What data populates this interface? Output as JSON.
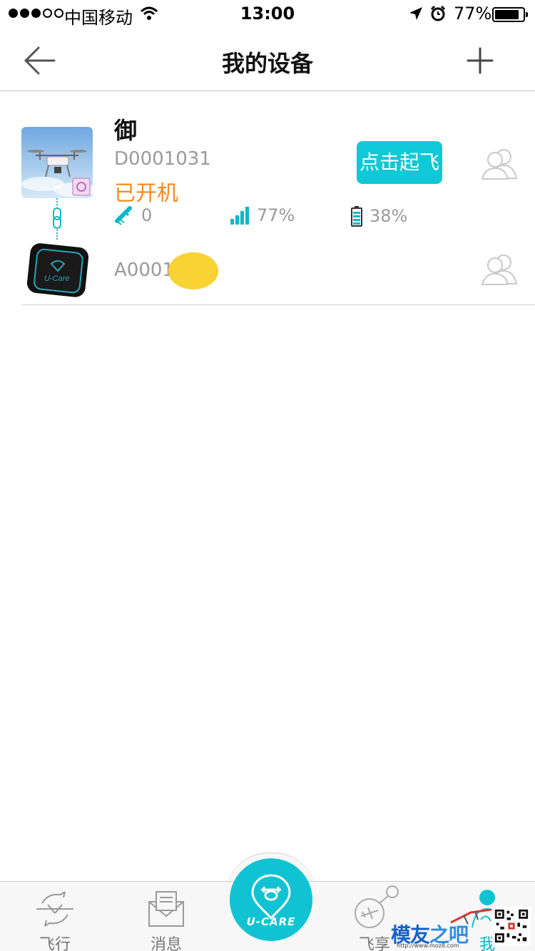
{
  "status_bar": {
    "carrier": "中国移动",
    "time": "13:00",
    "battery_percent": "77%"
  },
  "nav": {
    "title": "我的设备"
  },
  "device": {
    "name": "御",
    "id": "D0001031",
    "status": "已开机",
    "gps_count": "0",
    "signal": "77%",
    "battery": "38%",
    "takeoff_label": "点击起飞",
    "tracker_id": "A0001"
  },
  "tabs": {
    "fly": "飞行",
    "messages": "消息",
    "center_brand": "U-CARE",
    "share": "飞享",
    "me": "我"
  },
  "watermark": {
    "text_a": "模友",
    "text_b": "之吧",
    "url": "http://www.moz8.com"
  },
  "colors": {
    "accent": "#10c8d6",
    "status_on": "#f58a1f",
    "muted": "#9a9a9a"
  }
}
